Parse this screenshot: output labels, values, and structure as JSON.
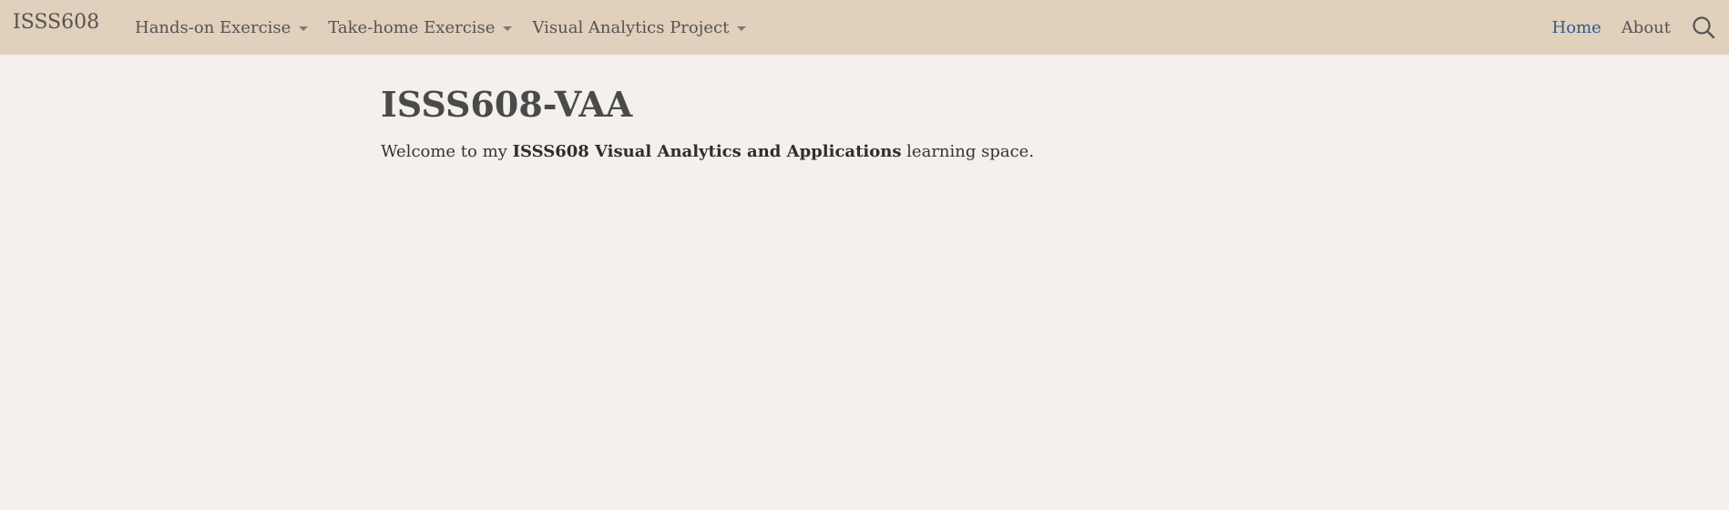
{
  "navbar": {
    "brand": "ISSS608",
    "menus": [
      {
        "label": "Hands-on Exercise"
      },
      {
        "label": "Take-home Exercise"
      },
      {
        "label": "Visual Analytics Project"
      }
    ],
    "right_links": [
      {
        "label": "Home",
        "active": true
      },
      {
        "label": "About",
        "active": false
      }
    ],
    "search_icon": "search-icon"
  },
  "main": {
    "title": "ISSS608-VAA",
    "intro_prefix": "Welcome to my ",
    "intro_bold": "ISSS608 Visual Analytics and Applications",
    "intro_suffix": " learning space."
  },
  "colors": {
    "navbar_bg": "#e1d0bb",
    "page_bg": "#f4f1ec",
    "active_link": "#2b5c92",
    "text": "#545454"
  }
}
